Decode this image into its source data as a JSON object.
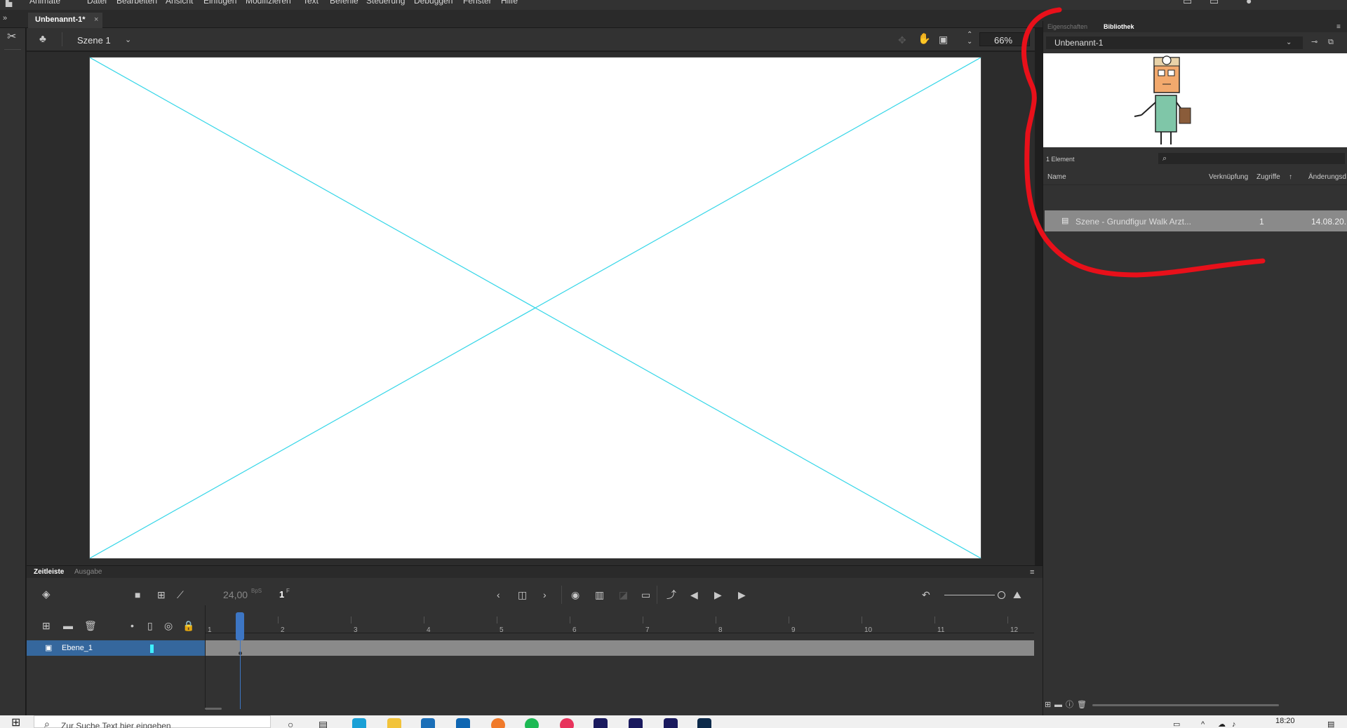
{
  "app": {
    "name": "Animate",
    "menu": [
      "Datei",
      "Bearbeiten",
      "Ansicht",
      "Einfügen",
      "Modifizieren",
      "Text",
      "Befehle",
      "Steuerung",
      "Debuggen",
      "Fenster",
      "Hilfe"
    ]
  },
  "document": {
    "tab_title": "Unbenannt-1*",
    "close_glyph": "×"
  },
  "editbar": {
    "scene_label": "Szene 1",
    "zoom": "66%"
  },
  "timeline": {
    "tabs": [
      "Zeitleiste",
      "Ausgabe"
    ],
    "fps": "24,00",
    "fps_unit": "BpS",
    "current_frame": "1",
    "frame_unit": "F",
    "frame_numbers": [
      "1",
      "2",
      "3",
      "4",
      "5",
      "6",
      "7",
      "8",
      "9",
      "10",
      "11",
      "12"
    ],
    "layer_name": "Ebene_1",
    "playhead_frame": 1
  },
  "library": {
    "tabs": [
      "Eigenschaften",
      "Bibliothek"
    ],
    "document_select": "Unbenannt-1",
    "item_count": "1 Element",
    "search_placeholder": "",
    "columns": [
      "Name",
      "Verknüpfung",
      "Zugriffe",
      "Änderungsd"
    ],
    "items": [
      {
        "name": "Szene - Grundfigur Walk Arzt...",
        "linkage": "",
        "uses": "1",
        "date": "14.08.20..."
      }
    ]
  },
  "taskbar": {
    "search_placeholder": "Zur Suche Text hier eingeben",
    "clock": "18:20"
  },
  "colors": {
    "accent": "#3d76c4",
    "guide": "#35d6e8",
    "annotation": "#e8101a",
    "layer_selected": "#35679d"
  }
}
